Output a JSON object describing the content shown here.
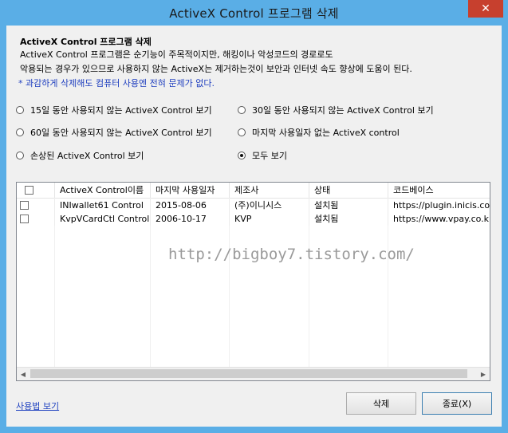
{
  "window": {
    "title": "ActiveX Control 프로그램 삭제",
    "close_label": "✕"
  },
  "header": {
    "title": "ActiveX Control 프로그램 삭제",
    "desc_line1": "ActiveX Control 프로그램은 순기능이 주목적이지만, 해킹이나 악성코드의 경로로도",
    "desc_line2": "악용되는 경우가 있으므로 사용하지 않는 ActiveX는 제거하는것이 보안과 인터넷 속도 향상에 도움이 된다.",
    "note": "* 과감하게 삭제해도 컴퓨터 사용엔 전혀 문제가 없다."
  },
  "filters": [
    {
      "label": "15일 동안 사용되지 않는 ActiveX Control 보기",
      "selected": false
    },
    {
      "label": "30일 동안 사용되지 않는 ActiveX Control 보기",
      "selected": false
    },
    {
      "label": "60일 동안 사용되지 않는 ActiveX Control 보기",
      "selected": false
    },
    {
      "label": "마지막 사용일자 없는 ActiveX control",
      "selected": false
    },
    {
      "label": "손상된 ActiveX Control 보기",
      "selected": false
    },
    {
      "label": "모두 보기",
      "selected": true
    }
  ],
  "table": {
    "columns": [
      "",
      "ActiveX Control이름",
      "마지막 사용일자",
      "제조사",
      "상태",
      "코드베이스"
    ],
    "rows": [
      [
        "",
        "INIwallet61 Control",
        "2015-08-06",
        "(주)이니시스",
        "설치됨",
        "https://plugin.inicis.com/"
      ],
      [
        "",
        "KvpVCardCtl Control",
        "2006-10-17",
        "KVP",
        "설치됨",
        "https://www.vpay.co.kr"
      ]
    ]
  },
  "watermark": "http://bigboy7.tistory.com/",
  "footer": {
    "help_link": "사용법 보기",
    "delete_button": "삭제",
    "close_button": "종료(X)"
  }
}
